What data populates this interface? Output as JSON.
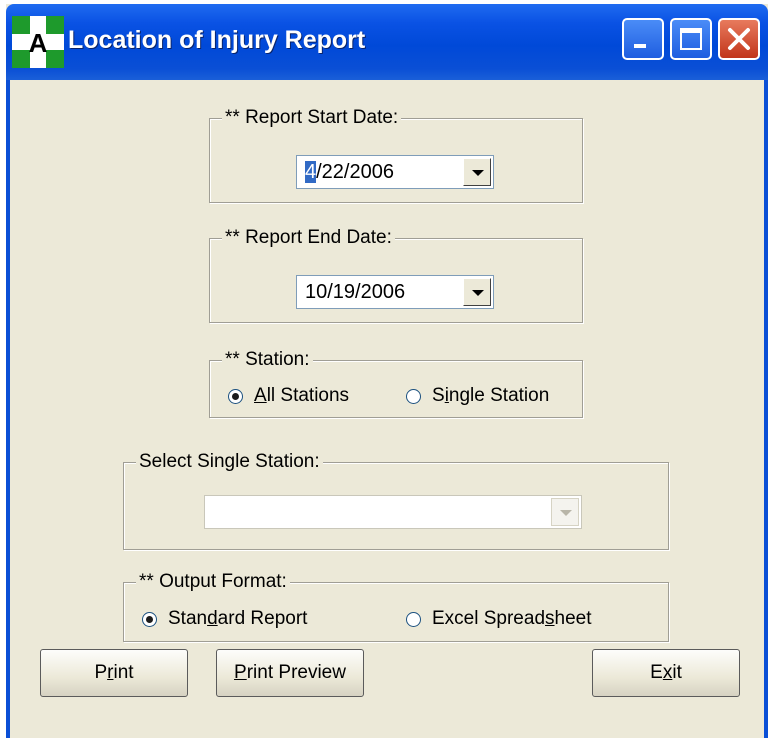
{
  "window": {
    "title": "Location of Injury Report",
    "app_icon_letter": "A",
    "minimize_label": "Minimize",
    "maximize_label": "Maximize",
    "close_label": "Close"
  },
  "start_date": {
    "label": "** Report Start Date:",
    "value_selected": "4",
    "value_rest": "/22/2006"
  },
  "end_date": {
    "label": "** Report End Date:",
    "value": "10/19/2006"
  },
  "station": {
    "label": "** Station:",
    "options": [
      {
        "prefix": "",
        "mnemonic": "A",
        "suffix": "ll Stations",
        "checked": true
      },
      {
        "prefix": "S",
        "mnemonic": "i",
        "suffix": "ngle Station",
        "checked": false
      }
    ]
  },
  "single_station": {
    "label": "Select Single Station:",
    "value": ""
  },
  "output_format": {
    "label": "** Output Format:",
    "options": [
      {
        "prefix": "Stan",
        "mnemonic": "d",
        "suffix": "ard Report",
        "checked": true
      },
      {
        "prefix": "Excel Spread",
        "mnemonic": "s",
        "suffix": "heet",
        "checked": false
      }
    ]
  },
  "buttons": {
    "print": {
      "prefix": "P",
      "mnemonic": "r",
      "suffix": "int"
    },
    "print_preview": {
      "prefix": "",
      "mnemonic": "P",
      "suffix": "rint Preview"
    },
    "exit": {
      "prefix": "E",
      "mnemonic": "x",
      "suffix": "it"
    }
  },
  "colors": {
    "titlebar": "#0a52e4",
    "dialog_bg": "#ece9d8",
    "selection": "#316ac5"
  }
}
